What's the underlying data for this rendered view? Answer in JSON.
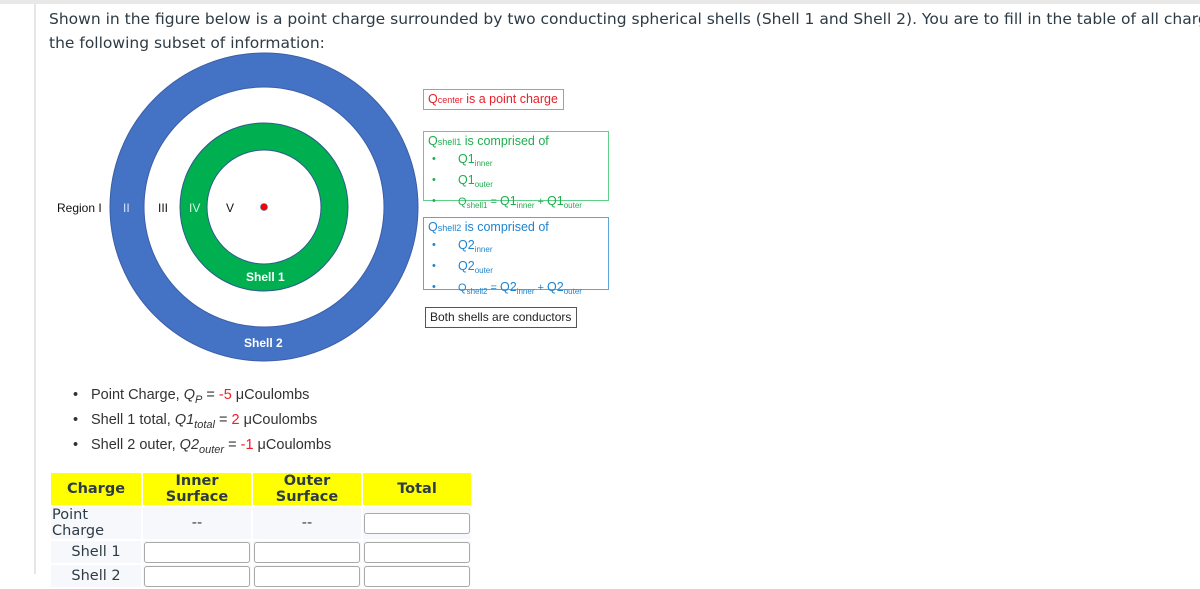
{
  "intro": {
    "line1": "Shown in the figure below is a point charge surrounded by two conducting spherical shells (Shell 1 and Shell 2). You are to fill in the table of all charges and all fields give",
    "line2": "the following subset of information:"
  },
  "figure": {
    "colors": {
      "shell1": "#00b050",
      "shell2": "#4472c4",
      "point_charge": "#ff0000"
    },
    "regions": [
      "Region I",
      "II",
      "III",
      "IV",
      "V"
    ],
    "shell1_label": "Shell 1",
    "shell2_label": "Shell 2"
  },
  "callouts": {
    "center": {
      "q": "Q",
      "sub": "center",
      "text": " is a point charge"
    },
    "shell1": {
      "q": "Q",
      "sub": "shell1",
      "text": " is comprised of",
      "items": [
        {
          "main": "Q1",
          "sub": "inner"
        },
        {
          "main": "Q1",
          "sub": "outer"
        }
      ],
      "formula": {
        "lhs_q": "Q",
        "lhs_sub": "shell1",
        "eq": " = ",
        "a": "Q1",
        "a_sub": "inner",
        "plus": " + ",
        "b": "Q1",
        "b_sub": "outer"
      }
    },
    "shell2": {
      "q": "Q",
      "sub": "shell2",
      "text": " is comprised of",
      "items": [
        {
          "main": "Q2",
          "sub": "inner"
        },
        {
          "main": "Q2",
          "sub": "outer"
        }
      ],
      "formula": {
        "lhs_q": "Q",
        "lhs_sub": "shell2",
        "eq": " = ",
        "a": "Q2",
        "a_sub": "inner",
        "plus": " + ",
        "b": "Q2",
        "b_sub": "outer"
      }
    },
    "note": "Both shells are conductors"
  },
  "given": [
    {
      "label": "Point Charge, ",
      "sym": "Q",
      "sym_sub": "P",
      "eq": " = ",
      "value": "-5",
      "unit": " μCoulombs"
    },
    {
      "label": "Shell 1 total, ",
      "sym": "Q1",
      "sym_sub": "total",
      "eq": " = ",
      "value": "2",
      "unit": " μCoulombs"
    },
    {
      "label": "Shell 2 outer, ",
      "sym": "Q2",
      "sym_sub": "outer",
      "eq": " = ",
      "value": "-1",
      "unit": " μCoulombs"
    }
  ],
  "table": {
    "headers": [
      "Charge",
      "Inner Surface",
      "Outer Surface",
      "Total"
    ],
    "rows": [
      {
        "label": "Point Charge",
        "inner": "--",
        "outer": "--",
        "total": ""
      },
      {
        "label": "Shell 1",
        "inner": "",
        "outer": "",
        "total": ""
      },
      {
        "label": "Shell 2",
        "inner": "",
        "outer": "",
        "total": ""
      }
    ]
  }
}
